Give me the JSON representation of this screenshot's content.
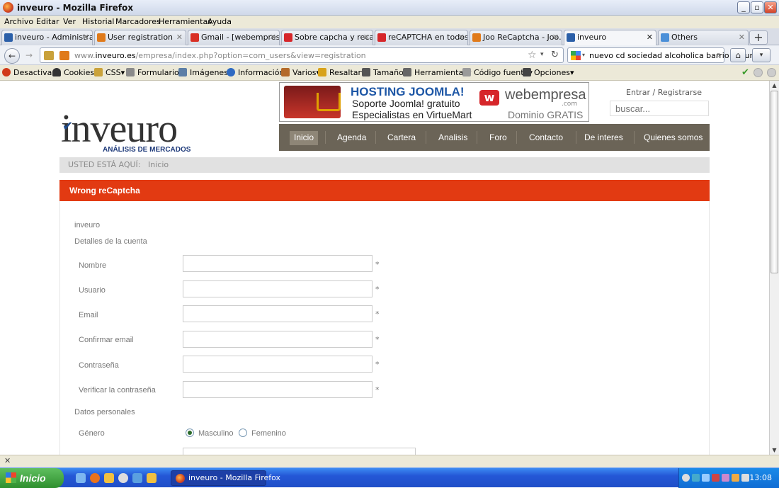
{
  "window": {
    "title": "inveuro - Mozilla Firefox",
    "btn_min": "_",
    "btn_max": "▫",
    "btn_close": "✕"
  },
  "menubar": [
    "Archivo",
    "Editar",
    "Ver",
    "Historial",
    "Marcadores",
    "Herramientas",
    "Ayuda"
  ],
  "tabs": [
    {
      "label": "inveuro - Administrac...",
      "color": "#2b5fa8"
    },
    {
      "label": "User registration",
      "color": "#e07a1a"
    },
    {
      "label": "Gmail - [webempresa...",
      "color": "#d93025"
    },
    {
      "label": "Sobre capcha y reca...",
      "color": "#d6262a"
    },
    {
      "label": "reCAPTCHA en todos...",
      "color": "#d6262a"
    },
    {
      "label": "Joo ReCaptcha - Joo...",
      "color": "#e07a1a"
    },
    {
      "label": "inveuro",
      "color": "#2b5fa8"
    },
    {
      "label": "Others",
      "color": "#4a8fd8"
    }
  ],
  "tab_close": "✕",
  "new_tab": "+",
  "nav": {
    "back": "←",
    "forward": "→",
    "url_prefix": "www.",
    "url_host": "inveuro.es",
    "url_path": "/empresa/index.php?option=com_users&view=registration",
    "search_query": "nuevo cd sociedad alcoholica barrio oscuro"
  },
  "toolbar": [
    "Desactivar▾",
    "Cookies▾",
    "CSS▾",
    "Formularios▾",
    "Imágenes▾",
    "Información▾",
    "Varios▾",
    "Resaltar▾",
    "Tamaño▾",
    "Herramientas▾",
    "Código fuente▾",
    "Opciones▾"
  ],
  "ad": {
    "headline": "HOSTING JOOMLA!",
    "line2": "Soporte Joomla! gratuito",
    "line3": "Especialistas en VirtueMart",
    "brand_mark": "w",
    "brand": "webempresa",
    "brand_com": ".com",
    "offer": "Dominio GRATIS"
  },
  "header": {
    "login": "Entrar / Registrarse",
    "search_placeholder": "buscar...",
    "logo": "inveuro",
    "logo_check": "✔",
    "logo_sub": "ANÁLISIS DE MERCADOS"
  },
  "mainmenu": [
    "Inicio",
    "Agenda",
    "Cartera",
    "Analisis",
    "Foro",
    "Contacto",
    "De interes",
    "Quienes somos"
  ],
  "breadcrumb": {
    "label": "USTED ESTÁ AQUÍ:",
    "current": "Inicio"
  },
  "error": "Wrong reCaptcha",
  "form": {
    "site": "inveuro",
    "section_account": "Detalles de la cuenta",
    "fields": [
      "Nombre",
      "Usuario",
      "Email",
      "Confirmar email",
      "Contraseña",
      "Verificar la contraseña"
    ],
    "required_mark": "*",
    "section_personal": "Datos personales",
    "gender_label": "Género",
    "gender_options": [
      "Masculino",
      "Femenino"
    ],
    "gender_selected": "Masculino"
  },
  "statusbar": {
    "close": "✕"
  },
  "taskbar": {
    "start": "Inicio",
    "task": "inveuro - Mozilla Firefox",
    "clock": "13:08"
  },
  "colors": {
    "error_bar": "#e23a12",
    "menu_bg": "#6b6457",
    "accent_blue": "#1e57a6"
  }
}
